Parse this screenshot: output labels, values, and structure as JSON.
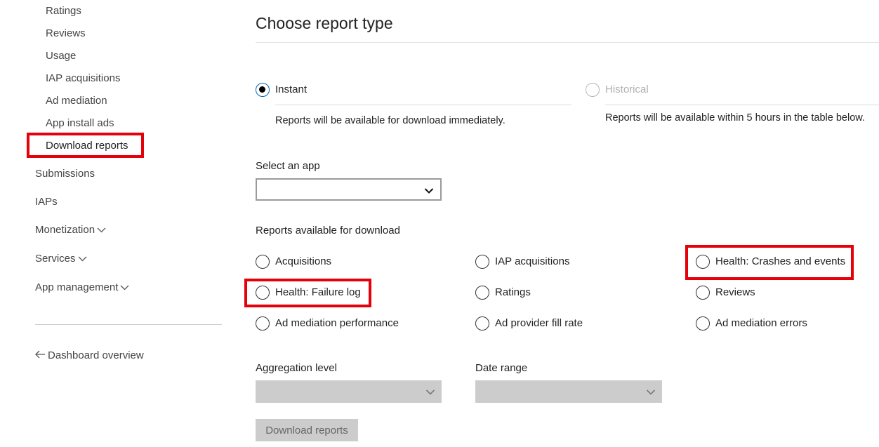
{
  "sidebar": {
    "subitems": [
      {
        "label": "Ratings"
      },
      {
        "label": "Reviews"
      },
      {
        "label": "Usage"
      },
      {
        "label": "IAP acquisitions"
      },
      {
        "label": "Ad mediation"
      },
      {
        "label": "App install ads"
      },
      {
        "label": "Download reports"
      }
    ],
    "items": [
      {
        "label": "Submissions"
      },
      {
        "label": "IAPs"
      },
      {
        "label": "Monetization"
      },
      {
        "label": "Services"
      },
      {
        "label": "App management"
      }
    ],
    "back_link": "Dashboard overview"
  },
  "main": {
    "title": "Choose report type",
    "type_options": [
      {
        "label": "Instant",
        "description": "Reports will be available for download immediately.",
        "selected": true,
        "enabled": true
      },
      {
        "label": "Historical",
        "description": "Reports will be available within 5 hours in the table below.",
        "selected": false,
        "enabled": false
      }
    ],
    "select_app": {
      "label": "Select an app",
      "value": ""
    },
    "reports_heading": "Reports available for download",
    "reports": [
      {
        "label": "Acquisitions"
      },
      {
        "label": "IAP acquisitions"
      },
      {
        "label": "Health: Crashes and events"
      },
      {
        "label": "Health: Failure log"
      },
      {
        "label": "Ratings"
      },
      {
        "label": "Reviews"
      },
      {
        "label": "Ad mediation performance"
      },
      {
        "label": "Ad provider fill rate"
      },
      {
        "label": "Ad mediation errors"
      }
    ],
    "aggregation": {
      "label": "Aggregation level",
      "value": ""
    },
    "date_range": {
      "label": "Date range",
      "value": ""
    },
    "download_button": "Download reports"
  },
  "colors": {
    "highlight": "#e6000a",
    "accent": "#0067b8",
    "disabled": "#cccccc"
  }
}
